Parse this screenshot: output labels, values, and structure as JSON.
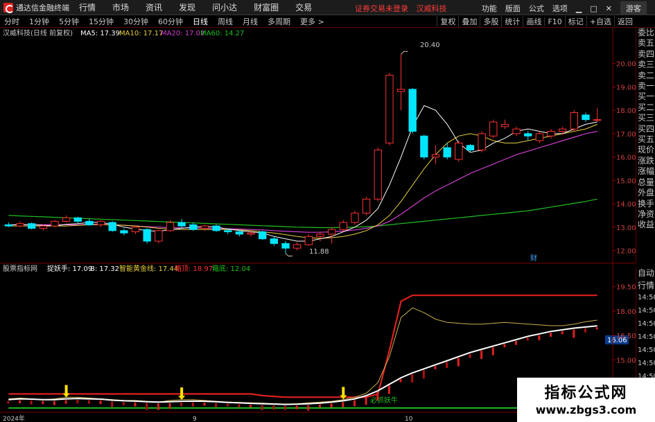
{
  "app": {
    "title": "通达信金融终端"
  },
  "menu": [
    "行情",
    "市场",
    "资讯",
    "发现",
    "问小达",
    "财富圈",
    "交易"
  ],
  "status": {
    "login": "证券交易未登录",
    "stock": "汉威科技"
  },
  "topRight": {
    "items": [
      "功能",
      "版面",
      "公式",
      "选项"
    ],
    "min": "▁",
    "restore": "□",
    "close": "✕",
    "guest": "游客"
  },
  "periods": [
    "分时",
    "1分钟",
    "5分钟",
    "15分钟",
    "30分钟",
    "60分钟",
    "日线",
    "周线",
    "月线",
    "多周期",
    "更多 >"
  ],
  "activePeriod": "日线",
  "toolbar": [
    "复权",
    "叠加",
    "多股",
    "统计",
    "画线",
    "F10",
    "标记",
    "+自选",
    "返回"
  ],
  "sidePanel": [
    "委比",
    "卖五",
    "卖四",
    "卖三",
    "卖二",
    "卖一",
    "买一",
    "买二",
    "买三",
    "买四",
    "买五",
    "现价",
    "涨跌",
    "涨幅",
    "总量",
    "外盘",
    "换手",
    "净资",
    "收益"
  ],
  "sidePanel2": [
    "自动",
    "行情"
  ],
  "timeCol": [
    "14:50",
    "14:50",
    "14:50",
    "14:50",
    "14:50",
    "14:50",
    "14:50",
    "14:50",
    "14:50"
  ],
  "upper": {
    "legend": {
      "name": "汉威科技(日线 前复权)",
      "ma5": "MA5: 17.39",
      "ma10": "MA10: 17.17",
      "ma20": "MA20: 17.02",
      "ma60": "MA60: 14.27"
    },
    "yticks": [
      "20.00",
      "19.00",
      "18.00",
      "17.00",
      "16.00",
      "15.00",
      "14.00",
      "13.00",
      "12.00"
    ],
    "high_label": "20.40",
    "low_label": "11.88",
    "marker": "财"
  },
  "lower": {
    "legend": {
      "name": "股票指标网",
      "line1": "捉妖手: 17.09",
      "line2": "B: 17.32",
      "line3": "智能黄金线: 17.44",
      "line4": "箱顶: 18.97",
      "line5": "箱底: 12.04"
    },
    "yticks": [
      "19.50",
      "18.00",
      "16.50",
      "15.00",
      "13.50"
    ],
    "current": "16.06",
    "annotation": "必抓妖牛"
  },
  "xaxis": [
    "2024年",
    "9",
    "10"
  ],
  "watermark": {
    "title": "指标公式网",
    "url": "www.zbgs3.com"
  },
  "colors": {
    "up": "#ff3232",
    "down": "#00e5ff",
    "ma5": "#ffffff",
    "ma10": "#e8d040",
    "ma20": "#d040d0",
    "ma60": "#20c020"
  },
  "chart_data": {
    "type": "candlestick",
    "candles": [
      [
        13.1,
        13.2,
        13.0,
        13.05
      ],
      [
        13.05,
        13.25,
        13.0,
        13.15
      ],
      [
        13.15,
        13.2,
        12.9,
        12.95
      ],
      [
        12.95,
        13.1,
        12.85,
        13.05
      ],
      [
        13.05,
        13.3,
        13.0,
        13.25
      ],
      [
        13.25,
        13.5,
        13.2,
        13.4
      ],
      [
        13.4,
        13.45,
        13.15,
        13.25
      ],
      [
        13.25,
        13.35,
        13.05,
        13.1
      ],
      [
        13.1,
        13.3,
        13.0,
        13.25
      ],
      [
        13.2,
        13.25,
        12.8,
        12.85
      ],
      [
        12.85,
        12.95,
        12.65,
        12.75
      ],
      [
        12.8,
        13.05,
        12.7,
        13.0
      ],
      [
        12.9,
        12.95,
        12.3,
        12.4
      ],
      [
        12.4,
        12.9,
        12.3,
        12.85
      ],
      [
        12.85,
        13.3,
        12.8,
        13.2
      ],
      [
        13.2,
        13.35,
        12.95,
        13.05
      ],
      [
        13.1,
        13.2,
        12.85,
        12.9
      ],
      [
        12.95,
        13.1,
        12.85,
        13.05
      ],
      [
        13.05,
        13.1,
        12.8,
        12.85
      ],
      [
        12.85,
        12.95,
        12.7,
        12.8
      ],
      [
        12.8,
        12.9,
        12.6,
        12.7
      ],
      [
        12.7,
        12.85,
        12.6,
        12.75
      ],
      [
        12.8,
        12.85,
        12.45,
        12.5
      ],
      [
        12.5,
        12.6,
        12.2,
        12.3
      ],
      [
        12.3,
        12.4,
        11.88,
        12.1
      ],
      [
        12.1,
        12.35,
        12.0,
        12.25
      ],
      [
        12.25,
        12.7,
        12.2,
        12.6
      ],
      [
        12.6,
        12.8,
        12.4,
        12.7
      ],
      [
        12.7,
        13.0,
        12.3,
        12.9
      ],
      [
        12.9,
        13.3,
        12.8,
        13.2
      ],
      [
        13.2,
        13.7,
        13.1,
        13.6
      ],
      [
        13.6,
        14.3,
        13.5,
        14.2
      ],
      [
        14.2,
        16.4,
        14.1,
        16.3
      ],
      [
        16.6,
        19.6,
        16.5,
        19.5
      ],
      [
        18.8,
        20.4,
        18.0,
        18.9
      ],
      [
        18.9,
        18.95,
        17.0,
        17.1
      ],
      [
        16.9,
        16.95,
        15.9,
        16.0
      ],
      [
        16.0,
        16.5,
        15.7,
        16.1
      ],
      [
        16.4,
        16.6,
        15.9,
        16.0
      ],
      [
        15.9,
        16.7,
        15.8,
        16.6
      ],
      [
        16.5,
        16.55,
        16.2,
        16.3
      ],
      [
        16.3,
        17.1,
        16.2,
        17.0
      ],
      [
        16.9,
        17.6,
        16.8,
        17.5
      ],
      [
        17.3,
        17.6,
        17.2,
        17.4
      ],
      [
        17.0,
        17.3,
        16.9,
        17.2
      ],
      [
        17.0,
        17.1,
        16.7,
        16.9
      ],
      [
        16.7,
        17.1,
        16.6,
        17.0
      ],
      [
        16.9,
        17.2,
        16.8,
        17.1
      ],
      [
        17.1,
        17.3,
        16.95,
        17.2
      ],
      [
        17.2,
        18.0,
        17.1,
        17.9
      ],
      [
        17.8,
        17.9,
        17.5,
        17.6
      ],
      [
        17.6,
        18.1,
        17.5,
        17.6
      ]
    ],
    "ma5": [
      13.1,
      13.1,
      13.1,
      13.08,
      13.05,
      13.12,
      13.15,
      13.2,
      13.2,
      13.12,
      13.0,
      12.92,
      12.85,
      12.82,
      12.9,
      12.95,
      13.0,
      13.02,
      13.0,
      12.92,
      12.85,
      12.8,
      12.75,
      12.6,
      12.5,
      12.4,
      12.4,
      12.5,
      12.6,
      12.8,
      13.0,
      13.3,
      13.8,
      14.8,
      16.0,
      17.3,
      18.2,
      18.0,
      17.4,
      16.6,
      16.2,
      16.3,
      16.6,
      16.8,
      17.1,
      17.2,
      17.1,
      17.0,
      17.0,
      17.2,
      17.4,
      17.5
    ],
    "ma10": [
      13.05,
      13.05,
      13.05,
      13.05,
      13.05,
      13.05,
      13.08,
      13.1,
      13.1,
      13.1,
      13.08,
      13.05,
      13.0,
      12.95,
      12.92,
      12.9,
      12.9,
      12.9,
      12.9,
      12.9,
      12.88,
      12.85,
      12.8,
      12.75,
      12.68,
      12.6,
      12.55,
      12.52,
      12.55,
      12.6,
      12.7,
      12.85,
      13.1,
      13.5,
      14.1,
      14.8,
      15.5,
      16.1,
      16.6,
      16.9,
      17.0,
      16.9,
      16.7,
      16.6,
      16.6,
      16.7,
      16.8,
      16.9,
      17.0,
      17.1,
      17.2,
      17.4
    ],
    "ma20": [
      13.1,
      13.1,
      13.1,
      13.1,
      13.1,
      13.1,
      13.1,
      13.12,
      13.12,
      13.1,
      13.08,
      13.05,
      13.02,
      13.0,
      12.98,
      12.97,
      12.96,
      12.95,
      12.94,
      12.93,
      12.92,
      12.9,
      12.88,
      12.85,
      12.82,
      12.8,
      12.78,
      12.78,
      12.8,
      12.83,
      12.88,
      12.95,
      13.05,
      13.25,
      13.55,
      13.9,
      14.25,
      14.55,
      14.8,
      15.05,
      15.3,
      15.5,
      15.7,
      15.9,
      16.1,
      16.25,
      16.4,
      16.55,
      16.7,
      16.85,
      17.0,
      17.1
    ],
    "ma60": [
      13.5,
      13.48,
      13.46,
      13.44,
      13.42,
      13.4,
      13.38,
      13.36,
      13.34,
      13.32,
      13.3,
      13.28,
      13.26,
      13.24,
      13.22,
      13.2,
      13.18,
      13.16,
      13.14,
      13.12,
      13.1,
      13.08,
      13.06,
      13.04,
      13.02,
      13.0,
      12.99,
      12.98,
      12.98,
      12.99,
      13.0,
      13.02,
      13.05,
      13.1,
      13.15,
      13.2,
      13.25,
      13.3,
      13.35,
      13.4,
      13.45,
      13.5,
      13.55,
      13.6,
      13.65,
      13.7,
      13.78,
      13.86,
      13.94,
      14.02,
      14.1,
      14.2
    ],
    "ylim": [
      11.6,
      21.0
    ],
    "indicator": {
      "box_top": [
        12.9,
        12.9,
        12.9,
        12.9,
        12.9,
        12.9,
        12.9,
        12.9,
        12.9,
        12.9,
        12.9,
        12.9,
        12.9,
        12.9,
        12.9,
        12.9,
        12.9,
        12.9,
        12.9,
        12.9,
        12.9,
        12.9,
        12.8,
        12.75,
        12.7,
        12.7,
        12.7,
        12.7,
        12.7,
        12.7,
        12.7,
        12.7,
        12.9,
        15.6,
        18.6,
        18.97,
        18.97,
        18.97,
        18.97,
        18.97,
        18.97,
        18.97,
        18.97,
        18.97,
        18.97,
        18.97,
        18.97,
        18.97,
        18.97,
        18.97,
        18.97,
        18.97
      ],
      "box_bottom": [
        12.04,
        12.04,
        12.04,
        12.04,
        12.04,
        12.04,
        12.04,
        12.04,
        12.04,
        12.04,
        12.04,
        12.04,
        12.04,
        12.04,
        12.04,
        12.04,
        12.04,
        12.04,
        12.04,
        12.04,
        12.04,
        12.04,
        12.04,
        12.04,
        12.04,
        12.04,
        12.04,
        12.04,
        12.04,
        12.04,
        12.04,
        12.04,
        12.04,
        12.04,
        12.04,
        12.04,
        12.04,
        12.04,
        12.04,
        12.04,
        12.04,
        12.04,
        12.04,
        12.04,
        12.04,
        12.04,
        12.04,
        12.04,
        12.04,
        12.04,
        12.04,
        12.04
      ],
      "gold_line": [
        12.6,
        12.65,
        12.6,
        12.55,
        12.6,
        12.7,
        12.7,
        12.65,
        12.6,
        12.55,
        12.5,
        12.5,
        12.45,
        12.4,
        12.5,
        12.55,
        12.55,
        12.5,
        12.45,
        12.4,
        12.38,
        12.36,
        12.34,
        12.3,
        12.28,
        12.3,
        12.35,
        12.4,
        12.45,
        12.55,
        12.7,
        12.95,
        13.6,
        15.2,
        17.6,
        18.2,
        17.9,
        17.5,
        17.3,
        17.25,
        17.2,
        17.2,
        17.25,
        17.3,
        17.25,
        17.2,
        17.15,
        17.1,
        17.1,
        17.2,
        17.35,
        17.44
      ],
      "catcher": [
        12.55,
        12.6,
        12.58,
        12.55,
        12.55,
        12.6,
        12.62,
        12.6,
        12.58,
        12.52,
        12.48,
        12.46,
        12.42,
        12.4,
        12.42,
        12.45,
        12.46,
        12.45,
        12.42,
        12.38,
        12.35,
        12.32,
        12.3,
        12.28,
        12.26,
        12.27,
        12.3,
        12.34,
        12.4,
        12.48,
        12.6,
        12.8,
        13.1,
        13.5,
        13.9,
        14.2,
        14.45,
        14.7,
        14.95,
        15.2,
        15.45,
        15.65,
        15.85,
        16.05,
        16.25,
        16.45,
        16.6,
        16.75,
        16.85,
        16.95,
        17.02,
        17.09
      ],
      "ylim": [
        11.9,
        20.0
      ]
    }
  }
}
